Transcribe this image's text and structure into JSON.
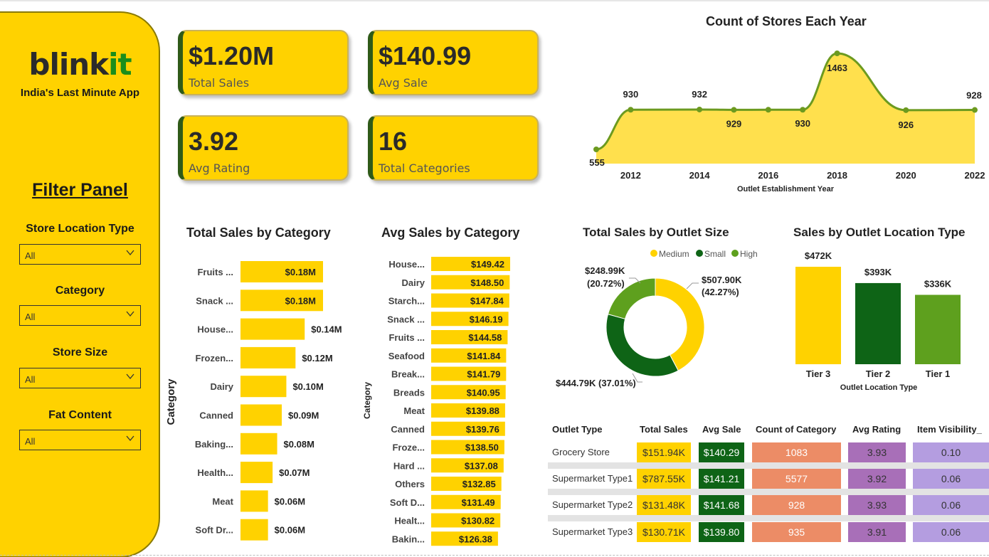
{
  "sidebar": {
    "brand_dark": "blink",
    "brand_green": "it",
    "tagline": "India's Last Minute App",
    "filter_title": "Filter Panel",
    "filters": [
      {
        "label": "Store Location Type",
        "value": "All"
      },
      {
        "label": "Category",
        "value": "All"
      },
      {
        "label": "Store Size",
        "value": "All"
      },
      {
        "label": "Fat Content",
        "value": "All"
      }
    ]
  },
  "kpis": [
    {
      "value": "$1.20M",
      "label": "Total Sales"
    },
    {
      "value": "$140.99",
      "label": "Avg Sale"
    },
    {
      "value": "3.92",
      "label": "Avg Rating"
    },
    {
      "value": "16",
      "label": "Total Categories"
    }
  ],
  "colors": {
    "yellow": "#FFD200",
    "dark_green": "#0E6416",
    "mid_green": "#5EA01E",
    "line_green": "#6C9A1F",
    "area_yellow": "#FFE04D",
    "salmon": "#EC8C66",
    "purple": "#A86FB8",
    "lavender": "#B49DE0"
  },
  "chart_data": [
    {
      "id": "stores_by_year",
      "type": "area",
      "title": "Count of Stores Each Year",
      "xlabel": "Outlet Establishment Year",
      "ylabel": "",
      "x": [
        2011,
        2012,
        2014,
        2015,
        2016,
        2017,
        2018,
        2020,
        2022
      ],
      "values": [
        555,
        930,
        932,
        929,
        930,
        930,
        1463,
        926,
        928
      ],
      "labels": [
        "555",
        "930",
        "932",
        "929",
        "",
        "930",
        "1463",
        "926",
        "928"
      ],
      "xticks": [
        2012,
        2014,
        2016,
        2018,
        2020,
        2022
      ],
      "xlim": [
        2011,
        2022
      ]
    },
    {
      "id": "sales_by_category",
      "type": "bar",
      "orientation": "horizontal",
      "title": "Total Sales by Category",
      "ylabel": "Category",
      "categories": [
        "Fruits ...",
        "Snack ...",
        "House...",
        "Frozen...",
        "Dairy",
        "Canned",
        "Baking...",
        "Health...",
        "Meat",
        "Soft Dr..."
      ],
      "values": [
        0.18,
        0.18,
        0.14,
        0.12,
        0.1,
        0.09,
        0.08,
        0.07,
        0.06,
        0.06
      ],
      "labels": [
        "$0.18M",
        "$0.18M",
        "$0.14M",
        "$0.12M",
        "$0.10M",
        "$0.09M",
        "$0.08M",
        "$0.07M",
        "$0.06M",
        "$0.06M"
      ],
      "xlim": [
        0,
        0.18
      ]
    },
    {
      "id": "avg_sales_by_category",
      "type": "bar",
      "orientation": "horizontal",
      "title": "Avg Sales by Category",
      "ylabel": "Category",
      "categories": [
        "House...",
        "Dairy",
        "Starch...",
        "Snack ...",
        "Fruits ...",
        "Seafood",
        "Break...",
        "Breads",
        "Meat",
        "Canned",
        "Froze...",
        "Hard ...",
        "Others",
        "Soft D...",
        "Healt...",
        "Bakin..."
      ],
      "values": [
        149.42,
        148.5,
        147.84,
        146.19,
        144.58,
        141.84,
        141.79,
        140.95,
        139.88,
        139.76,
        138.5,
        137.08,
        132.85,
        131.49,
        130.82,
        126.38
      ],
      "labels": [
        "$149.42",
        "$148.50",
        "$147.84",
        "$146.19",
        "$144.58",
        "$141.84",
        "$141.79",
        "$140.95",
        "$139.88",
        "$139.76",
        "$138.50",
        "$137.08",
        "$132.85",
        "$131.49",
        "$130.82",
        "$126.38"
      ],
      "xlim": [
        0,
        149.42
      ]
    },
    {
      "id": "sales_by_outlet_size",
      "type": "pie",
      "donut": true,
      "title": "Total Sales by Outlet Size",
      "legend": "top-right",
      "categories": [
        "Medium",
        "Small",
        "High"
      ],
      "values": [
        507.9,
        444.79,
        248.99
      ],
      "percent": [
        42.27,
        37.01,
        20.72
      ],
      "labels": [
        "$507.90K (42.27%)",
        "$444.79K (37.01%)",
        "$248.99K (20.72%)"
      ],
      "colors": [
        "#FFD200",
        "#0E6416",
        "#5EA01E"
      ]
    },
    {
      "id": "sales_by_location_type",
      "type": "bar",
      "title": "Sales by Outlet Location Type",
      "xlabel": "Outlet Location Type",
      "categories": [
        "Tier 3",
        "Tier 2",
        "Tier 1"
      ],
      "values": [
        472,
        393,
        336
      ],
      "labels": [
        "$472K",
        "$393K",
        "$336K"
      ],
      "colors": [
        "#FFD200",
        "#0E6416",
        "#5EA01E"
      ],
      "ylim": [
        0,
        472
      ]
    },
    {
      "id": "outlet_type_table",
      "type": "table",
      "columns": [
        "Outlet Type",
        "Total Sales",
        "Avg Sale",
        "Count of Category",
        "Avg Rating",
        "Item Visibility_"
      ],
      "rows": [
        [
          "Grocery Store",
          "$151.94K",
          "$140.29",
          "1083",
          "3.93",
          "0.10"
        ],
        [
          "Supermarket Type1",
          "$787.55K",
          "$141.21",
          "5577",
          "3.92",
          "0.06"
        ],
        [
          "Supermarket Type2",
          "$131.48K",
          "$141.68",
          "928",
          "3.93",
          "0.06"
        ],
        [
          "Supermarket Type3",
          "$130.71K",
          "$139.80",
          "935",
          "3.91",
          "0.06"
        ]
      ]
    }
  ]
}
